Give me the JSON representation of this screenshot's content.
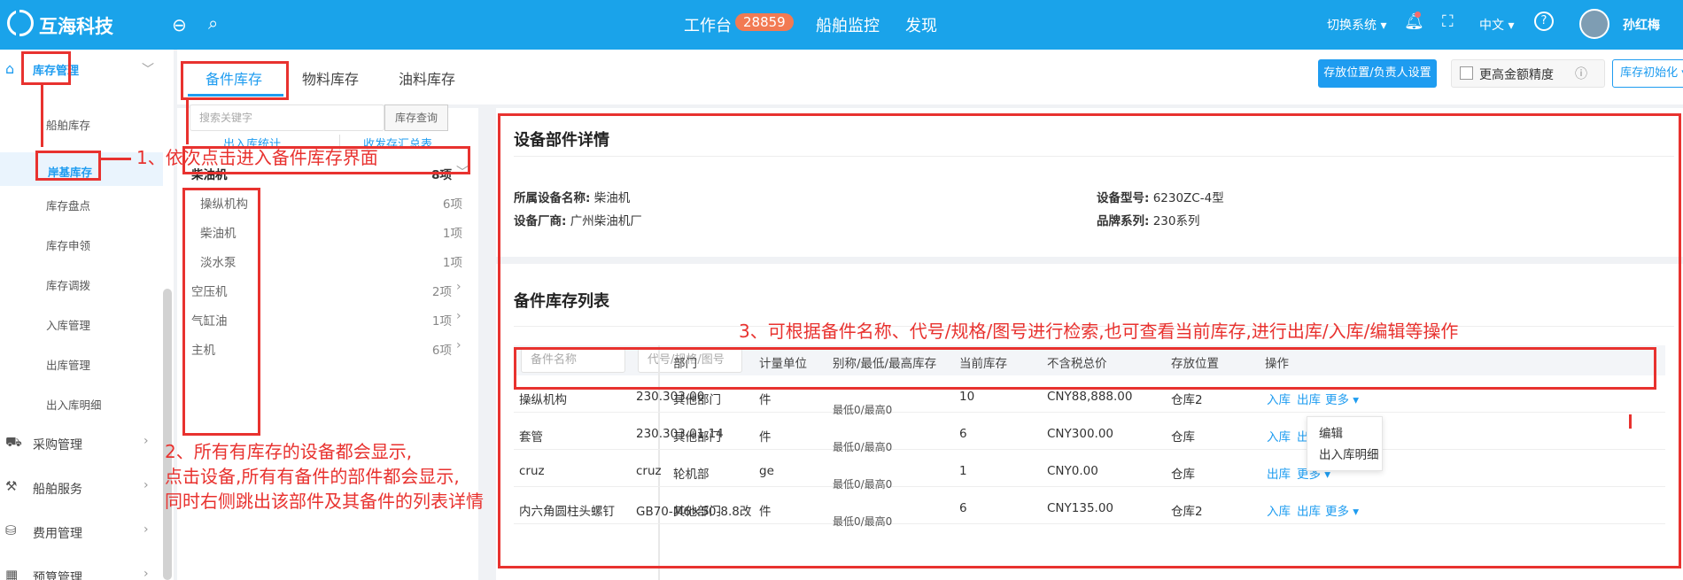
{
  "header": {
    "brand": "互海科技",
    "nav": [
      "工作台",
      "船舶监控",
      "发现"
    ],
    "workbench_count": "28859",
    "switch_system": "切换系统",
    "language": "中文",
    "username": "孙红梅",
    "brand_color": "#1aa3ea"
  },
  "sidebar": {
    "inventory_group": "库存管理",
    "items": [
      "船舶库存",
      "岸基库存",
      "库存盘点",
      "库存申领",
      "库存调拨",
      "入库管理",
      "出库管理",
      "出入库明细"
    ],
    "groups": [
      "采购管理",
      "船舶服务",
      "费用管理",
      "预算管理"
    ]
  },
  "tabs": [
    "备件库存",
    "物料库存",
    "油料库存"
  ],
  "toolbar": {
    "location_button": "存放位置/负责人设置",
    "precision_label": "更高金额精度",
    "init_button": "库存初始化"
  },
  "tree": {
    "search_placeholder": "搜索关键字",
    "search_button": "库存查询",
    "stat_in_out": "出入库统计",
    "stat_summary": "收发存汇总表",
    "nodes": [
      {
        "name": "柴油机",
        "count": "8项"
      },
      {
        "name": "操纵机构",
        "count": "6项"
      },
      {
        "name": "柴油机",
        "count": "1项"
      },
      {
        "name": "淡水泵",
        "count": "1项"
      },
      {
        "name": "空压机",
        "count": "2项"
      },
      {
        "name": "气缸油",
        "count": "1项"
      },
      {
        "name": "主机",
        "count": "6项"
      }
    ]
  },
  "detail": {
    "title": "设备部件详情",
    "device_name_label": "所属设备名称:",
    "device_name": "柴油机",
    "model_label": "设备型号:",
    "model": "6230ZC-4型",
    "maker_label": "设备厂商:",
    "maker": "广州柴油机厂",
    "brand_label": "品牌系列:",
    "brand": "230系列"
  },
  "list": {
    "title": "备件库存列表",
    "name_placeholder": "备件名称",
    "code_placeholder": "代号/规格/图号",
    "columns": [
      "部门",
      "计量单位",
      "别称/最低/最高库存",
      "当前库存",
      "不含税总价",
      "存放位置",
      "操作"
    ],
    "rows": [
      {
        "name": "操纵机构",
        "code": "230.303.00",
        "dept": "其他部门",
        "unit": "件",
        "minmax": "最低0/最高0",
        "stock": "10",
        "price": "CNY88,888.00",
        "loc": "仓库2"
      },
      {
        "name": "套管",
        "code": "230.303.01.14",
        "dept": "其他部门",
        "unit": "件",
        "minmax": "最低0/最高0",
        "stock": "6",
        "price": "CNY300.00",
        "loc": "仓库"
      },
      {
        "name": "cruz",
        "code": "cruz",
        "dept": "轮机部",
        "unit": "ge",
        "minmax": "最低0/最高0",
        "stock": "1",
        "price": "CNY0.00",
        "loc": "仓库"
      },
      {
        "name": "内六角圆柱头螺钉",
        "code": "GB70-M6×50-8.8改",
        "dept": "其他部门",
        "unit": "件",
        "minmax": "最低0/最高0",
        "stock": "6",
        "price": "CNY135.00",
        "loc": "仓库2"
      }
    ],
    "op_in": "入库",
    "op_out": "出库",
    "op_more": "更多",
    "op_in_short": "入库",
    "op_out_short": "出",
    "menu_edit": "编辑",
    "menu_detail": "出入库明细"
  },
  "annotations": {
    "step1": "1、依次点击进入备件库存界面",
    "step2_l1": "2、所有有库存的设备都会显示,",
    "step2_l2": "点击设备,所有有备件的部件都会显示,",
    "step2_l3": "同时右侧跳出该部件及其备件的列表详情",
    "step3": "3、可根据备件名称、代号/规格/图号进行检索,也可查看当前库存,进行出库/入库/编辑等操作",
    "color": "#e8322f"
  }
}
